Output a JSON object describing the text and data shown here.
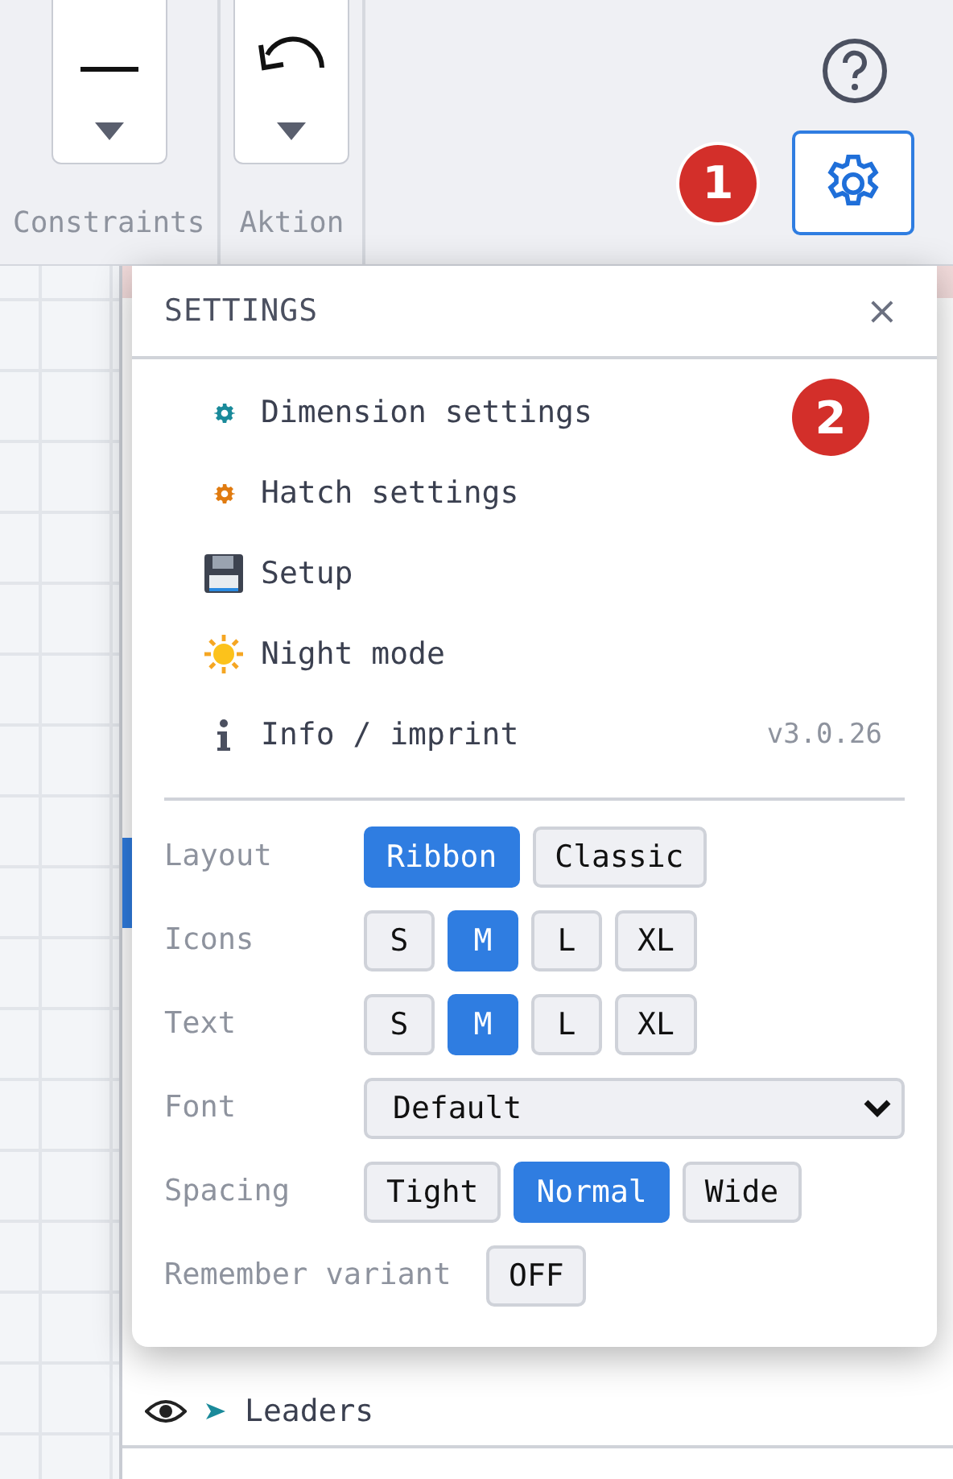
{
  "toolbar": {
    "groups": [
      {
        "label": "Constraints",
        "kind": "line"
      },
      {
        "label": "Aktion",
        "kind": "undo"
      }
    ],
    "badge": "1"
  },
  "layers": [
    {
      "label": "Leaders",
      "visible": true
    }
  ],
  "settings": {
    "title": "SETTINGS",
    "close": "×",
    "badge": "2",
    "menu": [
      {
        "label": "Dimension settings",
        "kind": "gear",
        "color": "#1a8a9a"
      },
      {
        "label": "Hatch settings",
        "kind": "gear",
        "color": "#e07b10"
      },
      {
        "label": "Setup",
        "kind": "floppy"
      },
      {
        "label": "Night mode",
        "kind": "sun"
      },
      {
        "label": "Info / imprint",
        "kind": "info",
        "version": "v3.0.26"
      }
    ],
    "options": [
      {
        "label": "Layout",
        "kind": "choices",
        "choices": [
          {
            "label": "Ribbon",
            "selected": true
          },
          {
            "label": "Classic",
            "selected": false
          }
        ]
      },
      {
        "label": "Icons",
        "kind": "choices",
        "choices": [
          {
            "label": "S",
            "selected": false
          },
          {
            "label": "M",
            "selected": true
          },
          {
            "label": "L",
            "selected": false
          },
          {
            "label": "XL",
            "selected": false
          }
        ]
      },
      {
        "label": "Text",
        "kind": "choices",
        "choices": [
          {
            "label": "S",
            "selected": false
          },
          {
            "label": "M",
            "selected": true
          },
          {
            "label": "L",
            "selected": false
          },
          {
            "label": "XL",
            "selected": false
          }
        ]
      },
      {
        "label": "Font",
        "kind": "select",
        "value": "Default"
      },
      {
        "label": "Spacing",
        "kind": "choices",
        "choices": [
          {
            "label": "Tight",
            "selected": false
          },
          {
            "label": "Normal",
            "selected": true
          },
          {
            "label": "Wide",
            "selected": false
          }
        ]
      },
      {
        "label": "Remember variant",
        "kind": "toggle",
        "value": "OFF"
      }
    ]
  }
}
